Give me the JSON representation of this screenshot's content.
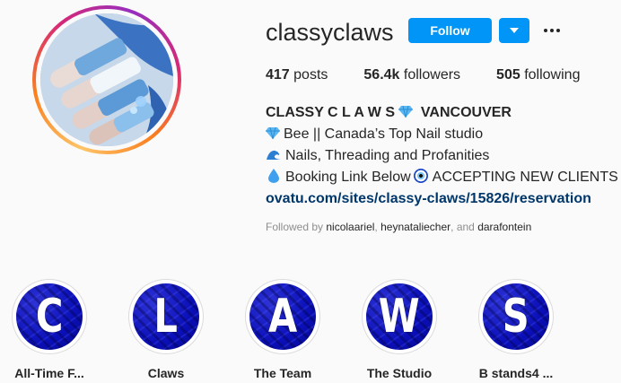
{
  "profile": {
    "username": "classyclaws",
    "follow_label": "Follow"
  },
  "stats": {
    "posts_count": "417",
    "posts_label": "posts",
    "followers_count": "56.4k",
    "followers_label": "followers",
    "following_count": "505",
    "following_label": "following"
  },
  "bio": {
    "name_part1": "CLASSY C L A W S",
    "name_part2": "VANCOUVER",
    "line1": "Bee || Canada’s Top Nail studio",
    "line2": "Nails, Threading and Profanities",
    "line3_a": "Booking Link Below",
    "line3_b": "ACCEPTING NEW CLIENTS",
    "link": "ovatu.com/sites/classy-claws/15826/reservation"
  },
  "followed_by": {
    "prefix": "Followed by",
    "user1": "nicolaariel",
    "sep": ",",
    "user2": "heynataliecher",
    "and": ", and",
    "user3": "darafontein"
  },
  "highlights": [
    {
      "letter": "C",
      "label": "All-Time F..."
    },
    {
      "letter": "L",
      "label": "Claws"
    },
    {
      "letter": "A",
      "label": "The Team"
    },
    {
      "letter": "W",
      "label": "The Studio"
    },
    {
      "letter": "S",
      "label": "B stands4 ..."
    }
  ],
  "colors": {
    "accent": "#0095f6",
    "link": "#00376b",
    "highlight_bg": "#0a0fb8"
  },
  "icons": [
    "gem-icon",
    "wave-icon",
    "droplet-icon",
    "nazar-eye-icon",
    "chevron-down-icon",
    "more-options-icon"
  ]
}
